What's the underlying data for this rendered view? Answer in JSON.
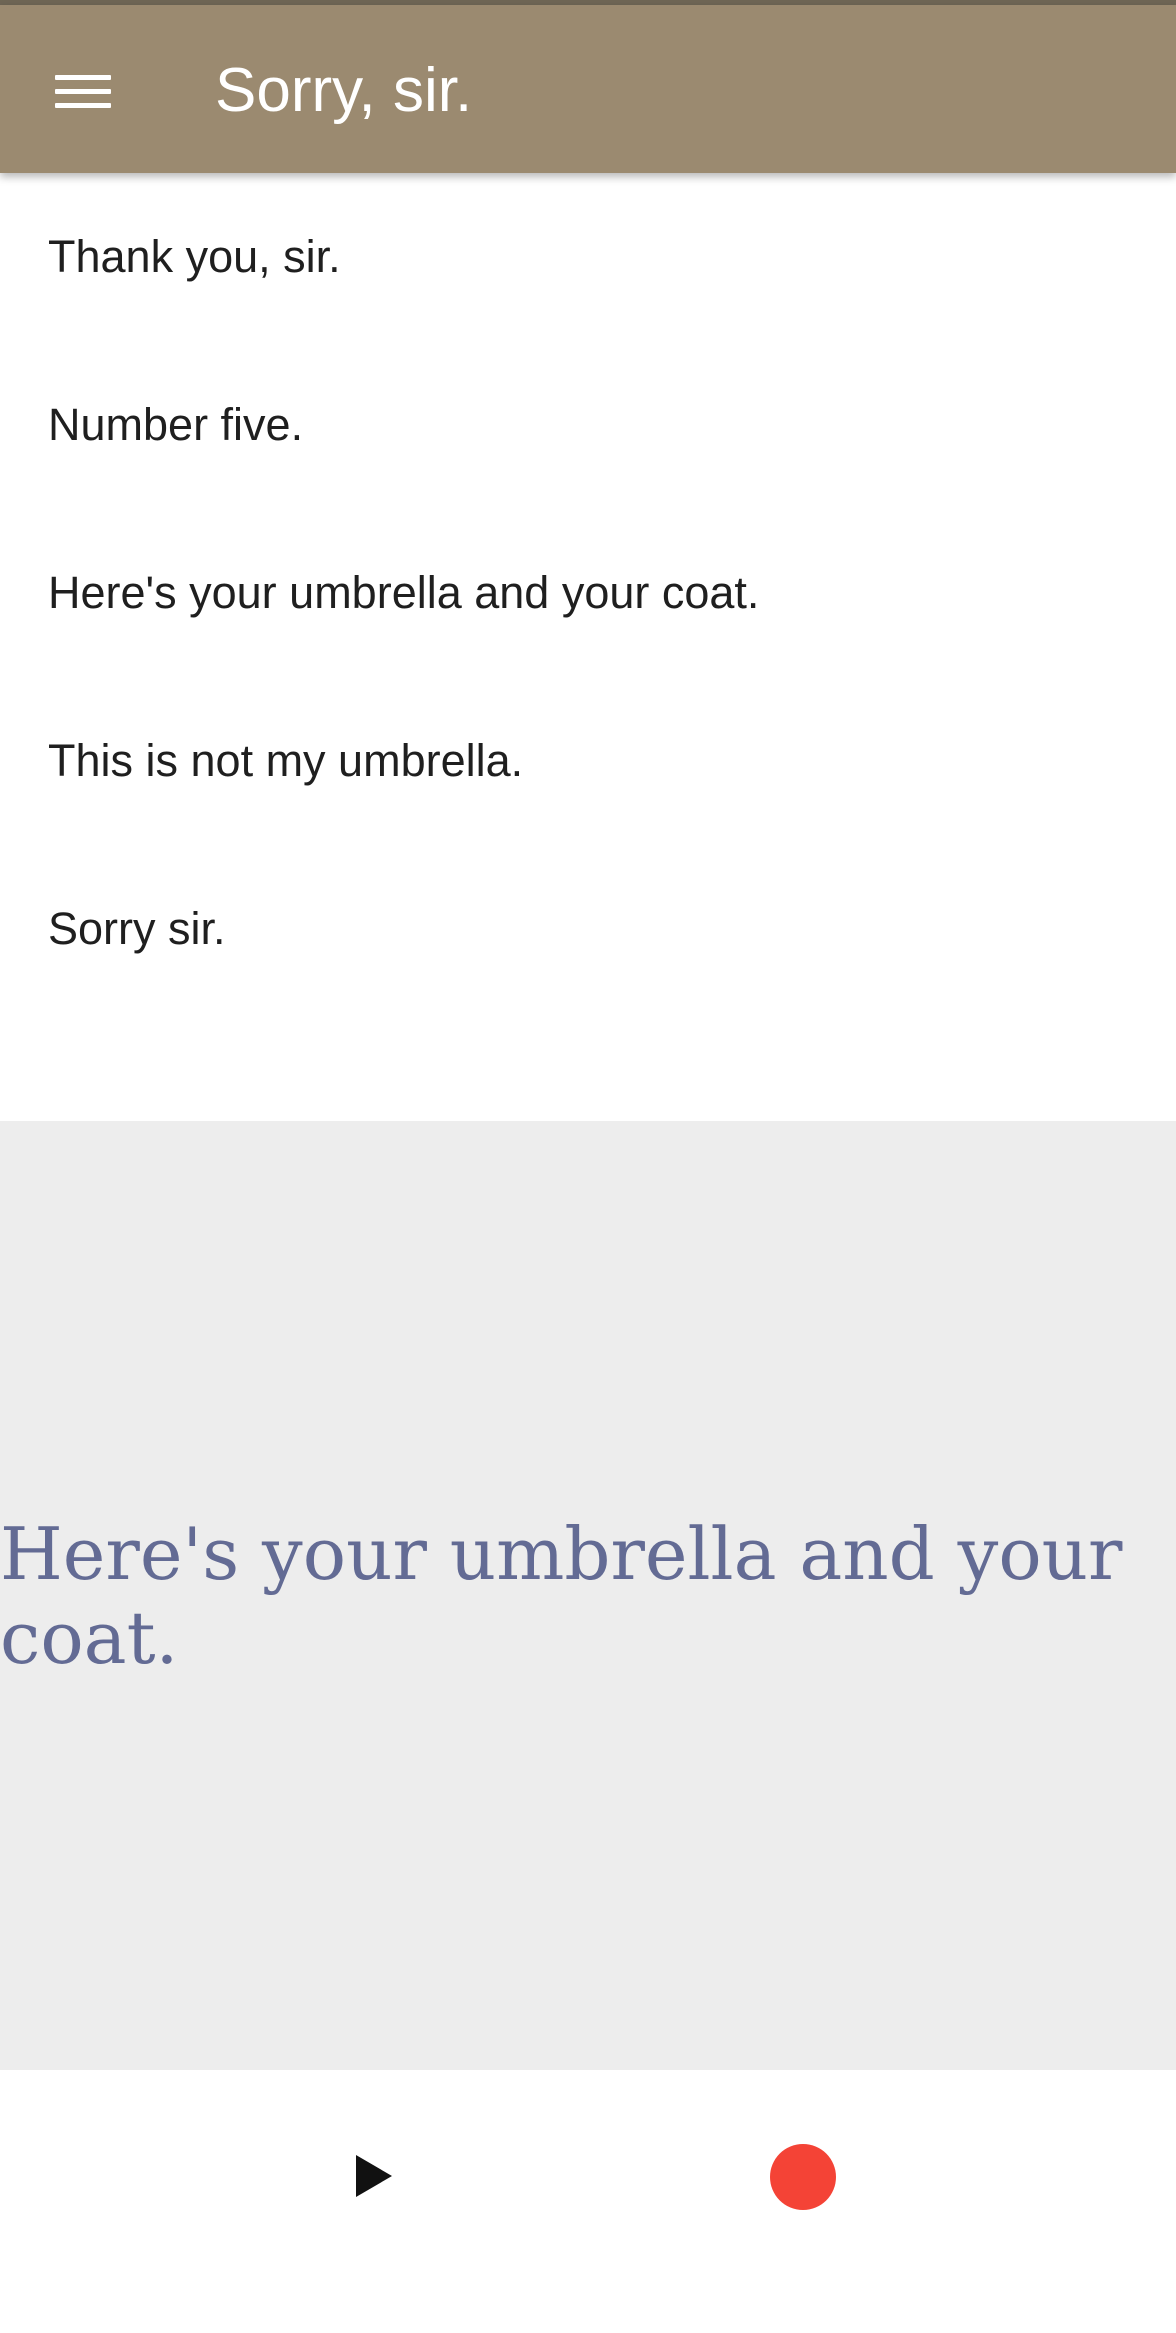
{
  "app_bar": {
    "title": "Sorry, sir.",
    "menu_icon": "hamburger-menu-icon",
    "background_color": "#9b8a70"
  },
  "sentences": [
    {
      "text": "Thank you, sir."
    },
    {
      "text": "Number five."
    },
    {
      "text": "Here's your umbrella and your coat."
    },
    {
      "text": "This is not my umbrella."
    },
    {
      "text": "Sorry sir."
    }
  ],
  "display": {
    "text": "Here's your umbrella and your coat.",
    "text_color": "#636b94",
    "background_color": "#ededed"
  },
  "controls": {
    "play_icon": "play-icon",
    "record_icon": "record-icon",
    "record_color": "#f44336"
  }
}
